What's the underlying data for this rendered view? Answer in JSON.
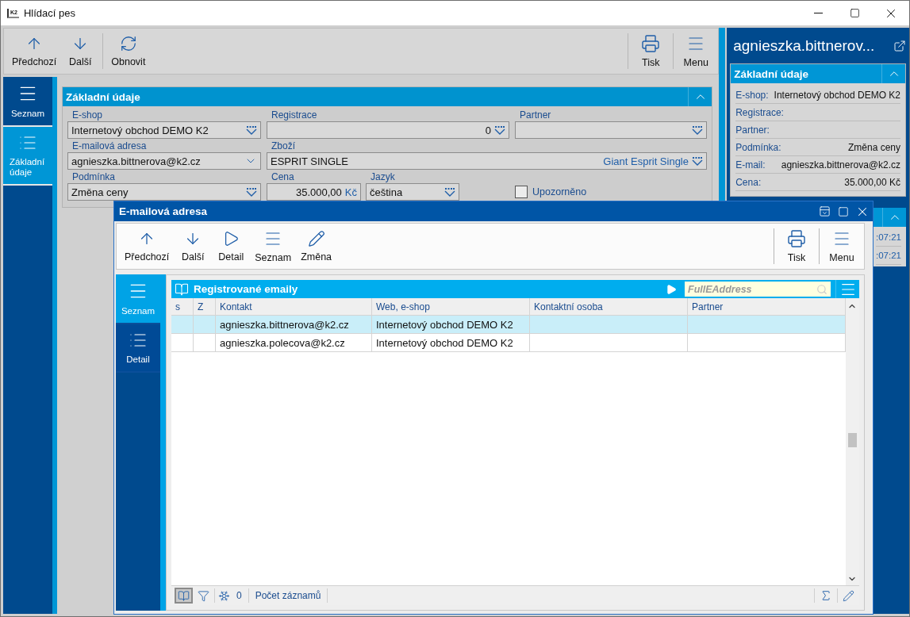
{
  "window": {
    "logo": "K2",
    "title": "Hlídací pes"
  },
  "toolbar": {
    "left": [
      {
        "label": "Předchozí",
        "kind": "up"
      },
      {
        "label": "Další",
        "kind": "down"
      },
      {
        "label": "Obnovit",
        "kind": "refresh"
      }
    ],
    "right": [
      {
        "label": "Tisk",
        "kind": "print"
      },
      {
        "label": "Menu",
        "kind": "menu"
      }
    ]
  },
  "sidebar": [
    {
      "label": "Seznam",
      "kind": "list",
      "selected": false
    },
    {
      "label": "Základní údaje",
      "kind": "outline",
      "selected": true
    }
  ],
  "section": {
    "title": "Základní údaje",
    "fields": [
      {
        "label": "E-shop",
        "kind": "lookup",
        "value": "Internetový obchod DEMO K2"
      },
      {
        "label": "Registrace",
        "kind": "lookup",
        "value": "0",
        "right_aligned": true
      },
      {
        "label": "Partner",
        "kind": "lookup"
      },
      {
        "label": "E-mailová adresa",
        "kind": "dropdown",
        "value": "agnieszka.bittnerova@k2.cz"
      },
      {
        "label": "Zboží",
        "kind": "lookup",
        "value": "ESPRIT SINGLE",
        "detail": "Giant Esprit Single",
        "wide": true
      },
      {
        "label": "Podmínka",
        "kind": "lookup",
        "value": "Změna ceny"
      },
      {
        "label": "Cena",
        "kind": "money",
        "value": "35.000,00",
        "unit": "Kč"
      },
      {
        "label": "Jazyk",
        "kind": "lookup",
        "value": "čeština"
      },
      {
        "label": "Upozorněno",
        "kind": "checkbox",
        "checked": false
      }
    ]
  },
  "preview": {
    "title": "agnieszka.bittnerov...",
    "section": {
      "title": "Základní údaje",
      "rows": [
        {
          "label": "E-shop:",
          "value": "Internetový obchod DEMO K2"
        },
        {
          "label": "Registrace:"
        },
        {
          "label": "Partner:"
        },
        {
          "label": "Podmínka:",
          "value": "Změna ceny"
        },
        {
          "label": "E-mail:",
          "value": "agnieszka.bittnerova@k2.cz"
        },
        {
          "label": "Cena:",
          "value": "35.000,00 Kč"
        }
      ]
    },
    "second_section": {
      "rows": [
        ":07:21",
        ":07:21"
      ]
    }
  },
  "dialog": {
    "title": "E-mailová adresa",
    "toolbar": {
      "left": [
        {
          "label": "Předchozí",
          "kind": "up"
        },
        {
          "label": "Další",
          "kind": "down"
        },
        {
          "label": "Detail",
          "kind": "detail"
        },
        {
          "label": "Seznam",
          "kind": "menu"
        },
        {
          "label": "Změna",
          "kind": "edit"
        }
      ],
      "right": [
        {
          "label": "Tisk",
          "kind": "print"
        },
        {
          "label": "Menu",
          "kind": "menu"
        }
      ]
    },
    "sidebar": [
      {
        "label": "Seznam",
        "kind": "list",
        "selected": true
      },
      {
        "label": "Detail",
        "kind": "outline",
        "selected": false
      }
    ],
    "grid": {
      "title": "Registrované emaily",
      "search": {
        "placeholder": "FullEAddress"
      },
      "columns": [
        "s",
        "Z",
        "Kontakt",
        "Web, e-shop",
        "Kontaktní osoba",
        "Partner"
      ],
      "rows": [
        {
          "contact": "agnieszka.bittnerova@k2.cz",
          "shop": "Internetový obchod DEMO K2",
          "selected": true
        },
        {
          "contact": "agnieszka.polecova@k2.cz",
          "shop": "Internetový obchod DEMO K2",
          "selected": false
        }
      ],
      "footer": {
        "count": "0",
        "label": "Počet záznamů"
      }
    }
  }
}
